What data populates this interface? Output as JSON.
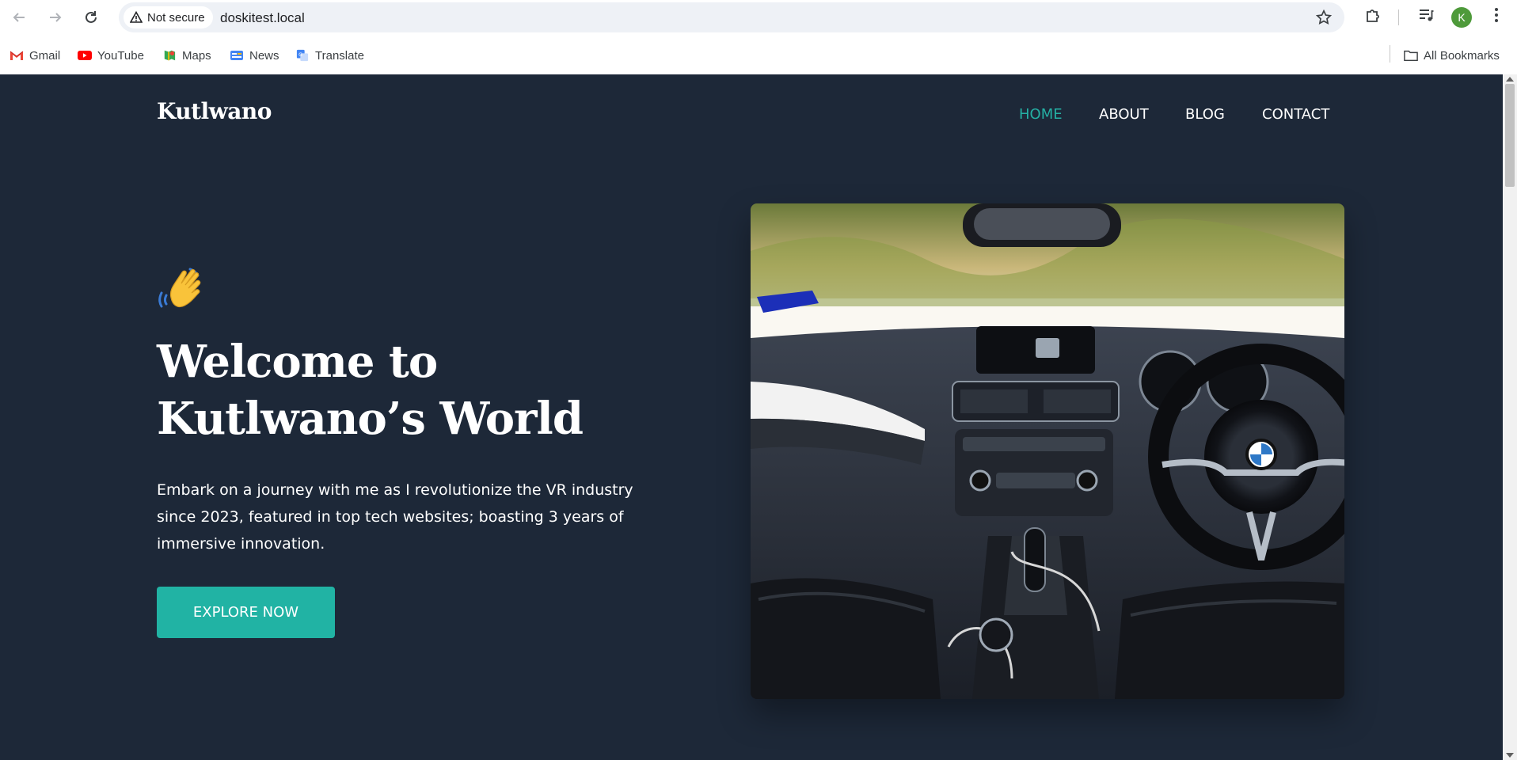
{
  "browser": {
    "security_label": "Not secure",
    "url": "doskitest.local",
    "profile_initial": "K",
    "bookmarks": [
      {
        "label": "Gmail",
        "icon": "gmail-icon"
      },
      {
        "label": "YouTube",
        "icon": "youtube-icon"
      },
      {
        "label": "Maps",
        "icon": "maps-icon"
      },
      {
        "label": "News",
        "icon": "news-icon"
      },
      {
        "label": "Translate",
        "icon": "translate-icon"
      }
    ],
    "all_bookmarks_label": "All Bookmarks"
  },
  "site": {
    "logo": "Kutlwano",
    "nav": [
      {
        "label": "HOME",
        "active": true
      },
      {
        "label": "ABOUT",
        "active": false
      },
      {
        "label": "BLOG",
        "active": false
      },
      {
        "label": "CONTACT",
        "active": false
      }
    ]
  },
  "hero": {
    "wave_emoji": "👋",
    "title": "Welcome to Kutlwano’s World",
    "description": "Embark on a journey with me as I revolutionize the VR industry since 2023, featured in top tech websites; boasting 3 years of immersive innovation.",
    "cta_label": "EXPLORE NOW",
    "image_subject": "car-interior-image"
  },
  "colors": {
    "page_bg": "#1d2838",
    "accent": "#21b3a4",
    "nav_active": "#25b0a4",
    "text": "#ffffff"
  }
}
